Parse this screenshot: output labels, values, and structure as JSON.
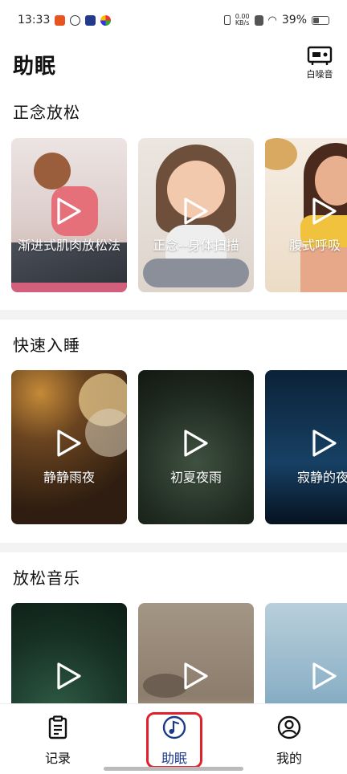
{
  "status_bar": {
    "time": "13:33",
    "net_speed_value": "0.00",
    "net_speed_unit": "KB/s",
    "battery_percent": "39%",
    "battery_level": 0.39
  },
  "header": {
    "title": "助眠",
    "white_noise_label": "白噪音"
  },
  "sections": [
    {
      "title": "正念放松",
      "cards": [
        {
          "label": "渐进式肌肉放松法",
          "bg": "#e7e0de"
        },
        {
          "label": "正念--身体扫描",
          "bg": "#e5dfd9"
        },
        {
          "label": "腹式呼吸",
          "bg": "#f1e5d6"
        }
      ]
    },
    {
      "title": "快速入睡",
      "cards": [
        {
          "label": "静静雨夜",
          "bg": "#3c2a1b"
        },
        {
          "label": "初夏夜雨",
          "bg": "#243026"
        },
        {
          "label": "寂静的夜",
          "bg": "#0f2c48"
        }
      ]
    },
    {
      "title": "放松音乐",
      "cards": [
        {
          "label": "",
          "bg": "#1d3a2c"
        },
        {
          "label": "",
          "bg": "#8f8172"
        },
        {
          "label": "",
          "bg": "#7ea6bd"
        }
      ]
    }
  ],
  "tabbar": {
    "tabs": [
      {
        "label": "记录",
        "icon": "clipboard-icon"
      },
      {
        "label": "助眠",
        "icon": "music-note-icon",
        "active": true
      },
      {
        "label": "我的",
        "icon": "user-icon"
      }
    ]
  },
  "colors": {
    "active_tab": "#1d3a8a",
    "highlight_border": "#e0202a"
  }
}
